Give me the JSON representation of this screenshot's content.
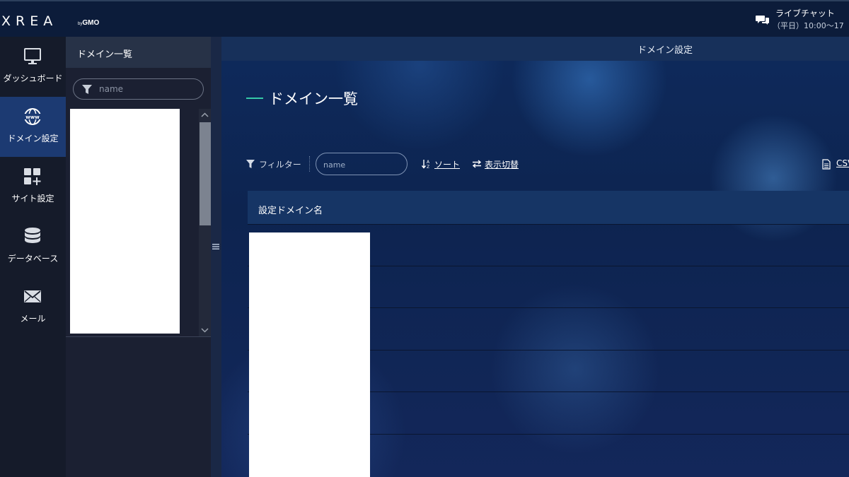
{
  "brand": {
    "logo": "XREA",
    "by": "by",
    "company": "GMO"
  },
  "chat": {
    "title": "ライブチャット",
    "hours": "（平日）10:00～17",
    "icon": "chat-bubbles-icon"
  },
  "nav": {
    "items": [
      {
        "label": "ダッシュボード",
        "icon": "monitor-icon"
      },
      {
        "label": "ドメイン設定",
        "icon": "www-globe-icon",
        "active": true
      },
      {
        "label": "サイト設定",
        "icon": "grid-plus-icon"
      },
      {
        "label": "データベース",
        "icon": "database-icon"
      },
      {
        "label": "メール",
        "icon": "envelope-icon"
      }
    ]
  },
  "panel": {
    "title": "ドメイン一覧",
    "search_placeholder": "name"
  },
  "main": {
    "header_title": "ドメイン設定",
    "heading": "ドメイン一覧",
    "toolbar": {
      "filter_label": "フィルター",
      "filter_placeholder": "name",
      "sort_label": "ソート",
      "switch_label": "表示切替",
      "csv_label": "CSV"
    },
    "table": {
      "column_header": "設定ドメイン名"
    }
  },
  "colors": {
    "accent": "#35c9a8",
    "active_nav": "#1c3a72",
    "nav_bg": "#151b2a",
    "panel_bg": "#1b2032"
  }
}
